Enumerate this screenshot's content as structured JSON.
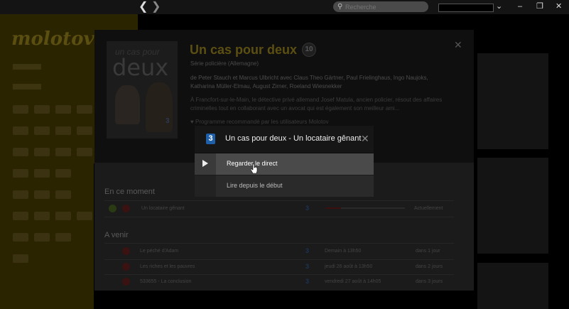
{
  "topbar": {
    "back_icon": "chevron-left-icon",
    "forward_icon": "chevron-right-icon",
    "search_placeholder": "Recherche",
    "search_icon": "search-icon",
    "window_controls": [
      "chevron-down-icon",
      "minimize-icon",
      "restore-icon",
      "close-icon"
    ]
  },
  "sidebar": {
    "logo": "molotov"
  },
  "program": {
    "title": "Un cas pour deux",
    "age_rating": "10",
    "genre": "Série policière (Allemagne)",
    "cast": "de Peter Stauch et Marcus Ulbricht avec Claus Theo Gärtner, Paul Frielinghaus, Ingo Naujoks, Katharina Müller-Elmau, August Zirner, Roeland Wiesnekker",
    "synopsis": "À Francfort-sur-le-Main, le détective privé allemand Josef Matula, ancien policier, résout des affaires criminelles tout en collaborant avec un avocat qui est également son meilleur ami...",
    "recommendation": "Programme recommandé par les utilisateurs Molotov",
    "cover_text_small": "un cas pour",
    "cover_text_big": "deux",
    "cover_channel": "3"
  },
  "now": {
    "heading": "En ce moment",
    "rows": [
      {
        "title": "Un locataire gênant",
        "channel": "3",
        "status": "Actuellement",
        "progress": 0.2
      }
    ]
  },
  "upcoming": {
    "heading": "A venir",
    "rows": [
      {
        "title": "Le péché d'Adam",
        "channel": "3",
        "when": "Demain à 13h50",
        "duration": "dans 1 jour"
      },
      {
        "title": "Les riches et les pauvres",
        "channel": "3",
        "when": "jeudi 26 août à 13h50",
        "duration": "dans 2 jours"
      },
      {
        "title": "533655 - La conclusion",
        "channel": "3",
        "when": "vendredi 27 août à 14h05",
        "duration": "dans 3 jours"
      }
    ]
  },
  "popup": {
    "channel_logo": "3",
    "title": "Un cas pour deux - Un locataire gênant",
    "close_icon": "close-icon",
    "options": [
      {
        "label": "Regarder le direct",
        "icon": "play-icon"
      },
      {
        "label": "Lire depuis le début",
        "icon": ""
      }
    ]
  },
  "colors": {
    "accent_yellow": "#5c4f12",
    "channel_blue": "#1f5fa8",
    "highlight_row": "#4a4a4a"
  }
}
